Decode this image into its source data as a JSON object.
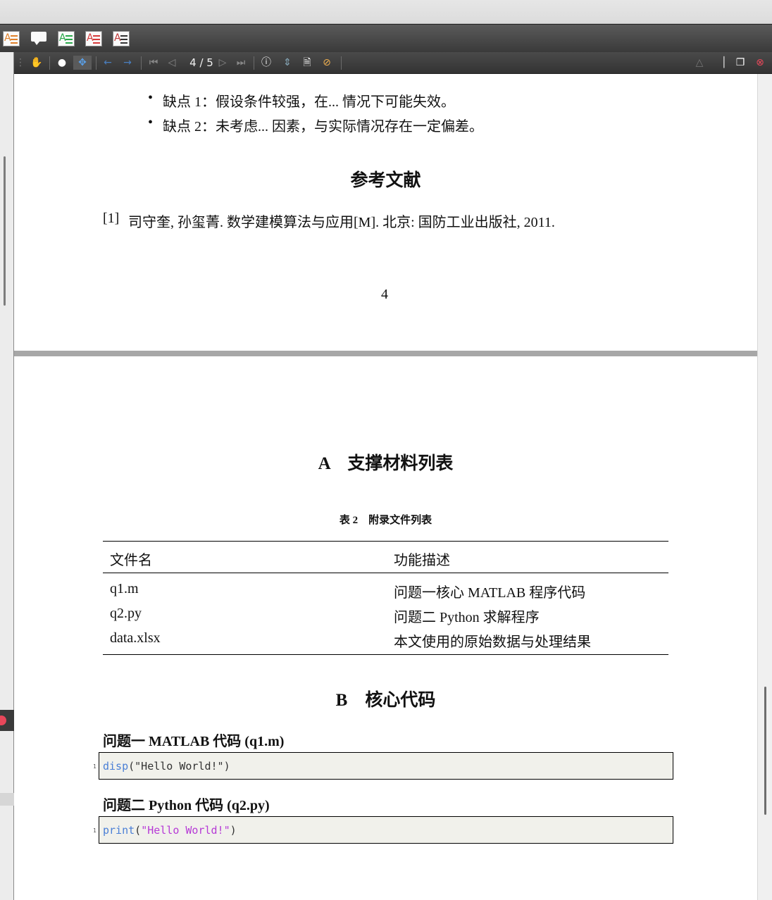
{
  "viewer": {
    "page_counter": "4 / 5",
    "icons": {
      "toolbar1": [
        "text-annotation-orange-icon",
        "comment-icon",
        "text-annotation-green-icon",
        "text-annotation-red-icon",
        "text-annotation-plain-icon"
      ],
      "toolbar2": [
        "pan-tool-icon",
        "circle-select-icon",
        "move-icon",
        "back-arrow-icon",
        "forward-arrow-icon",
        "first-page-icon",
        "prev-page-icon",
        "next-page-icon",
        "last-page-icon",
        "info-icon",
        "fit-icon",
        "export-icon",
        "link-icon",
        "scroll-up-icon",
        "sidebar-icon",
        "window-icon",
        "close-icon"
      ]
    },
    "accent_close": "#e8475a"
  },
  "page4": {
    "bullets": [
      "缺点 1：假设条件较强，在... 情况下可能失效。",
      "缺点 2：未考虑... 因素，与实际情况存在一定偏差。"
    ],
    "refs_title": "参考文献",
    "ref1_num": "[1]",
    "ref1_text": "司守奎, 孙玺菁. 数学建模算法与应用[M]. 北京: 国防工业出版社, 2011.",
    "page_number": "4"
  },
  "page5": {
    "sectionA": "A　支撑材料列表",
    "table_caption": "表 2　附录文件列表",
    "table": {
      "headers": [
        "文件名",
        "功能描述"
      ],
      "rows": [
        [
          "q1.m",
          "问题一核心 MATLAB 程序代码"
        ],
        [
          "q2.py",
          "问题二 Python 求解程序"
        ],
        [
          "data.xlsx",
          "本文使用的原始数据与处理结果"
        ]
      ]
    },
    "sectionB": "B　核心代码",
    "code1_title": "问题一 MATLAB 代码 (q1.m)",
    "code1": {
      "line": "1",
      "fn": "disp",
      "rest": "(\"Hello World!\")"
    },
    "code2_title": "问题二 Python 代码 (q2.py)",
    "code2": {
      "line": "1",
      "fn": "print",
      "open": "(",
      "str": "\"Hello World!\"",
      "close": ")"
    }
  }
}
